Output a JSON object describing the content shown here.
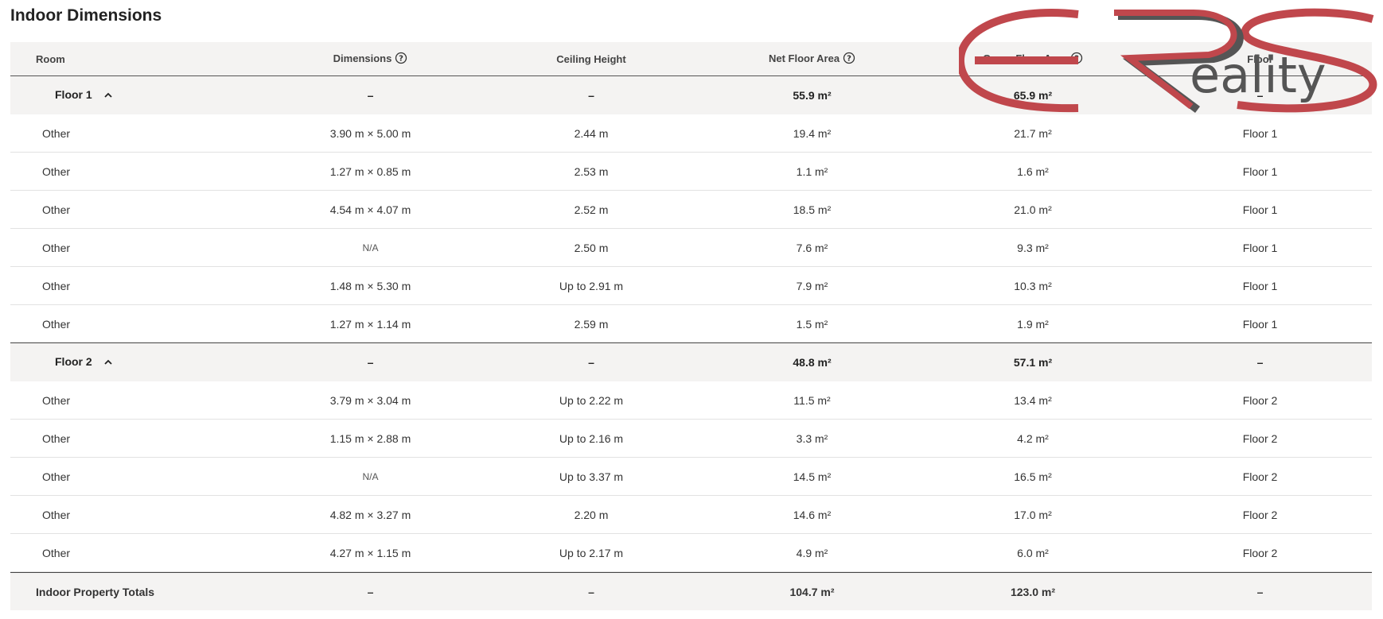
{
  "title": "Indoor Dimensions",
  "headers": [
    "Room",
    "Dimensions",
    "Ceiling Height",
    "Net Floor Area",
    "Gross Floor Area",
    "Floor"
  ],
  "floors": [
    {
      "summary": [
        "Floor 1",
        "–",
        "–",
        "55.9 m²",
        "65.9 m²",
        "–"
      ],
      "rows": [
        [
          "Other",
          "3.90 m × 5.00 m",
          "2.44 m",
          "19.4 m²",
          "21.7 m²",
          "Floor 1"
        ],
        [
          "Other",
          "1.27 m × 0.85 m",
          "2.53 m",
          "1.1 m²",
          "1.6 m²",
          "Floor 1"
        ],
        [
          "Other",
          "4.54 m × 4.07 m",
          "2.52 m",
          "18.5 m²",
          "21.0 m²",
          "Floor 1"
        ],
        [
          "Other",
          "N/A",
          "2.50 m",
          "7.6 m²",
          "9.3 m²",
          "Floor 1"
        ],
        [
          "Other",
          "1.48 m × 5.30 m",
          "Up to 2.91 m",
          "7.9 m²",
          "10.3 m²",
          "Floor 1"
        ],
        [
          "Other",
          "1.27 m × 1.14 m",
          "2.59 m",
          "1.5 m²",
          "1.9 m²",
          "Floor 1"
        ]
      ]
    },
    {
      "summary": [
        "Floor 2",
        "–",
        "–",
        "48.8 m²",
        "57.1 m²",
        "–"
      ],
      "rows": [
        [
          "Other",
          "3.79 m × 3.04 m",
          "Up to 2.22 m",
          "11.5 m²",
          "13.4 m²",
          "Floor 2"
        ],
        [
          "Other",
          "1.15 m × 2.88 m",
          "Up to 2.16 m",
          "3.3 m²",
          "4.2 m²",
          "Floor 2"
        ],
        [
          "Other",
          "N/A",
          "Up to 3.37 m",
          "14.5 m²",
          "16.5 m²",
          "Floor 2"
        ],
        [
          "Other",
          "4.82 m × 3.27 m",
          "2.20 m",
          "14.6 m²",
          "17.0 m²",
          "Floor 2"
        ],
        [
          "Other",
          "4.27 m × 1.15 m",
          "Up to 2.17 m",
          "4.9 m²",
          "6.0 m²",
          "Floor 2"
        ]
      ]
    }
  ],
  "totals": [
    "Indoor Property Totals",
    "–",
    "–",
    "104.7 m²",
    "123.0 m²",
    "–"
  ],
  "watermark": {
    "text": "eality"
  },
  "colors": {
    "header_bg": "#f4f3f2",
    "logo_red": "#c0474c",
    "logo_grey": "#555555"
  },
  "icons": {
    "help": "help-circle-icon",
    "collapse": "chevron-up-icon"
  }
}
